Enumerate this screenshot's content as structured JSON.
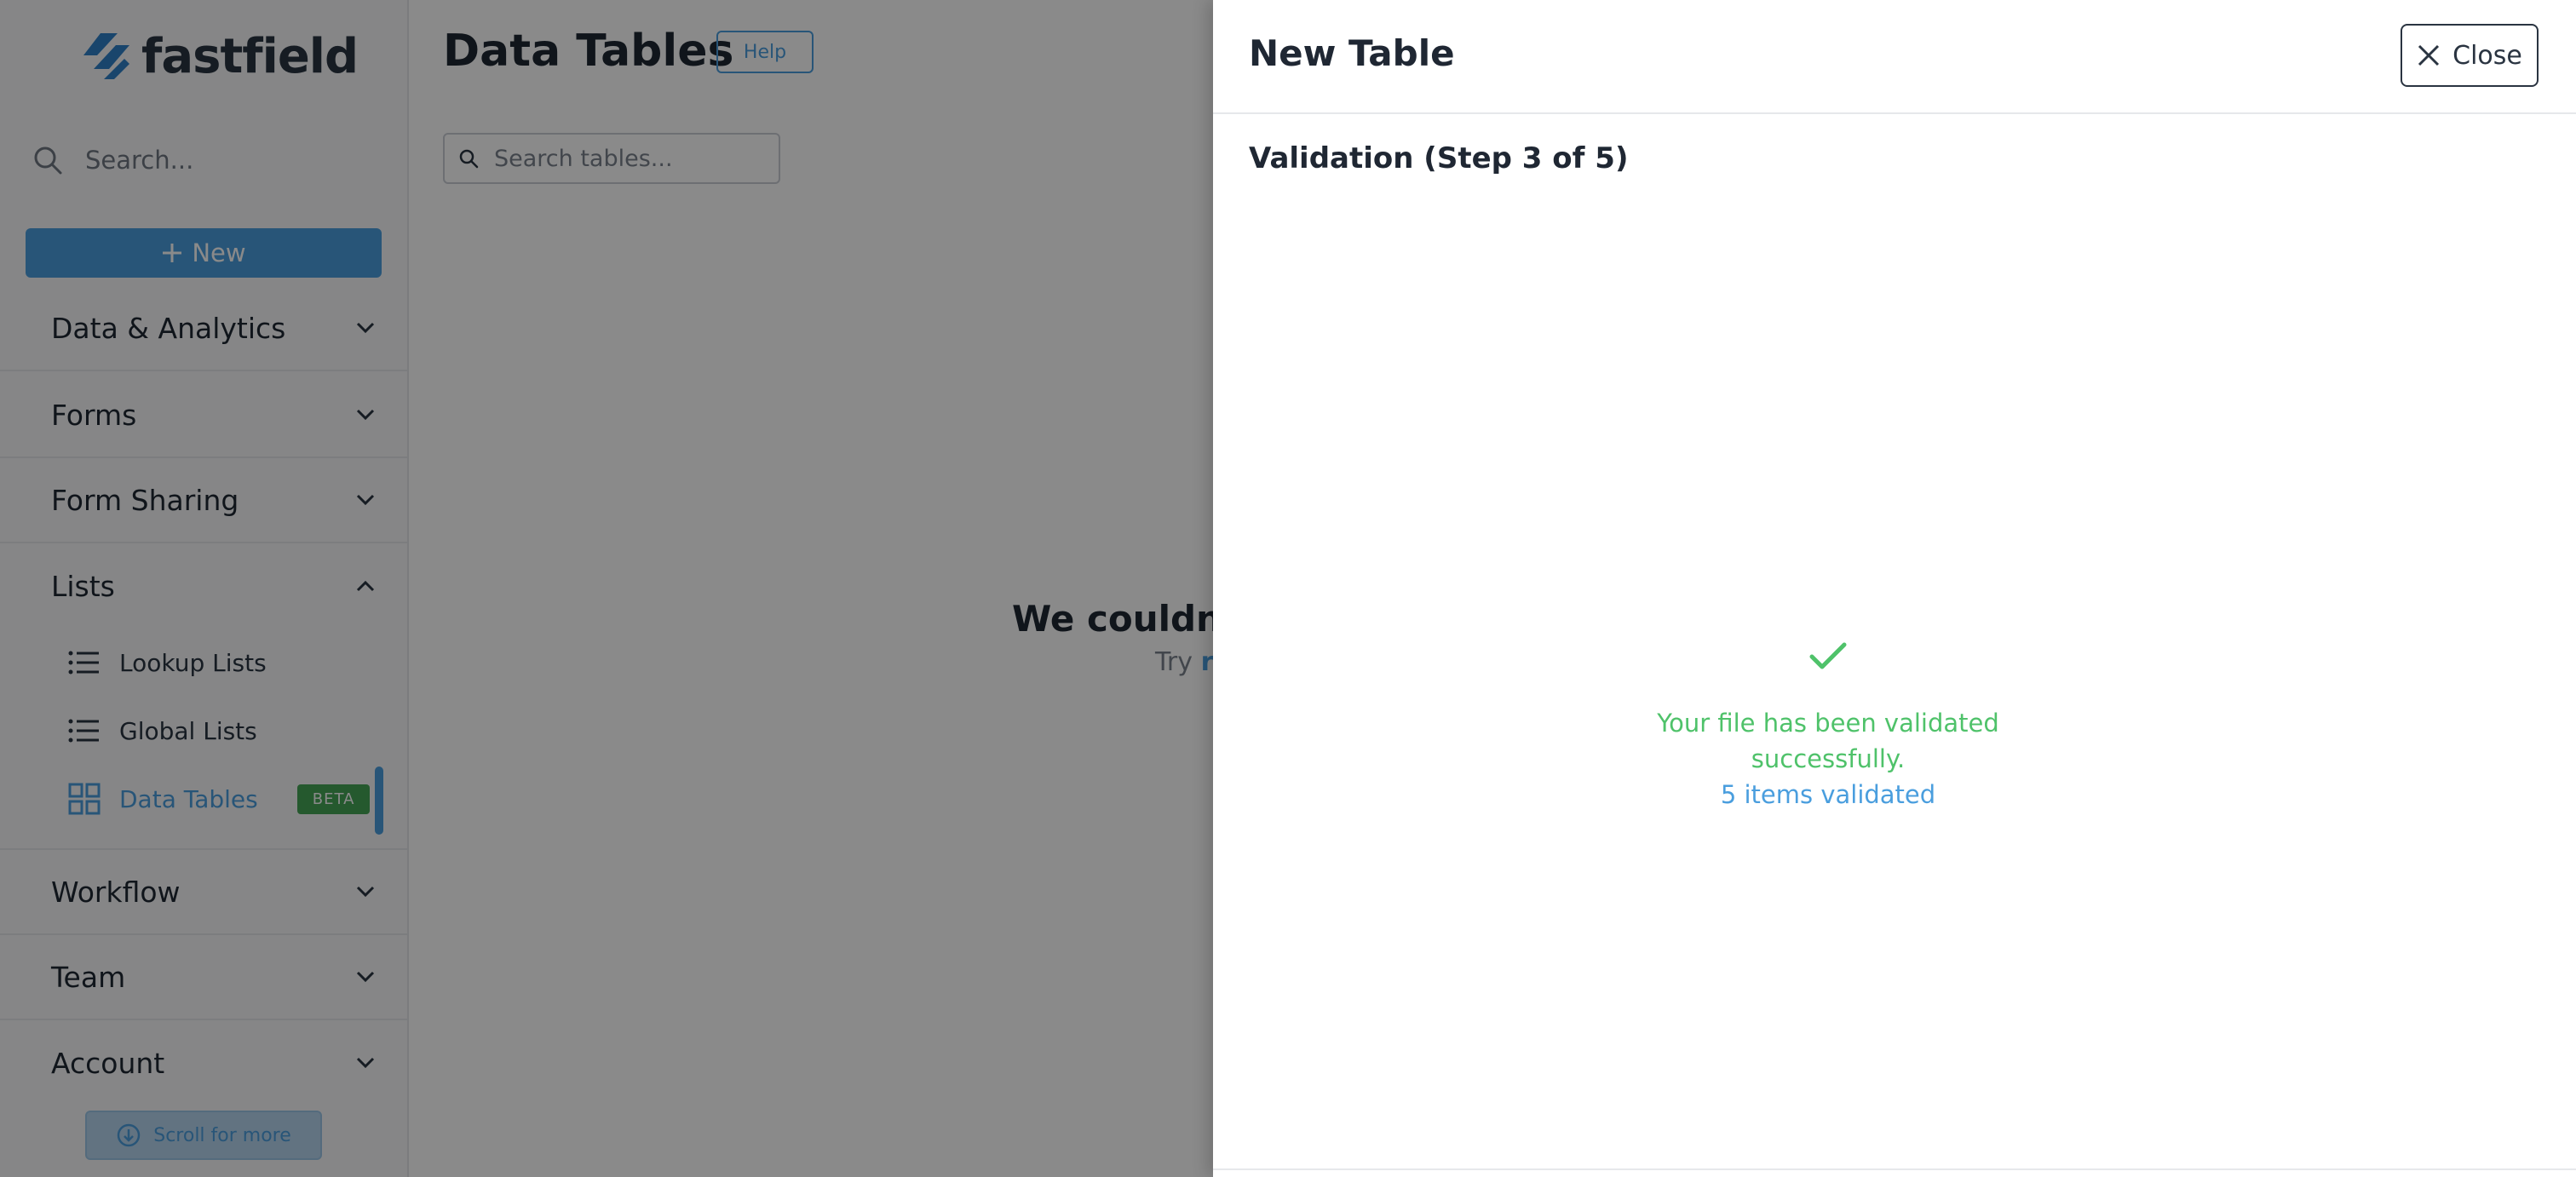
{
  "sidebar": {
    "logo_text": "fastfield",
    "search_placeholder": "Search...",
    "new_button_label": "New",
    "sections": [
      {
        "label": "Data & Analytics",
        "expanded": false
      },
      {
        "label": "Forms",
        "expanded": false
      },
      {
        "label": "Form Sharing",
        "expanded": false
      },
      {
        "label": "Lists",
        "expanded": true
      },
      {
        "label": "Workflow",
        "expanded": false
      },
      {
        "label": "Team",
        "expanded": false
      },
      {
        "label": "Account",
        "expanded": false
      }
    ],
    "list_items": [
      {
        "label": "Lookup Lists",
        "icon": "list-icon"
      },
      {
        "label": "Global Lists",
        "icon": "list-icon"
      },
      {
        "label": "Data Tables",
        "icon": "grid-icon",
        "badge": "BETA",
        "active": true
      }
    ],
    "scroll_more_label": "Scroll for more"
  },
  "main": {
    "title": "Data Tables",
    "help_label": "Help",
    "search_placeholder": "Search tables...",
    "empty_title": "We couldn't",
    "empty_hint_prefix": "Try",
    "empty_hint_link": "r"
  },
  "drawer": {
    "title": "New Table",
    "close_label": "Close",
    "step_title": "Validation (Step 3 of 5)",
    "validation_message_line1": "Your file has been validated",
    "validation_message_line2": "successfully.",
    "validation_count": "5 items validated"
  },
  "colors": {
    "accent": "#4a9ede",
    "success": "#4fc26a",
    "beta_badge": "#45a456",
    "text_dark": "#1f2733"
  }
}
